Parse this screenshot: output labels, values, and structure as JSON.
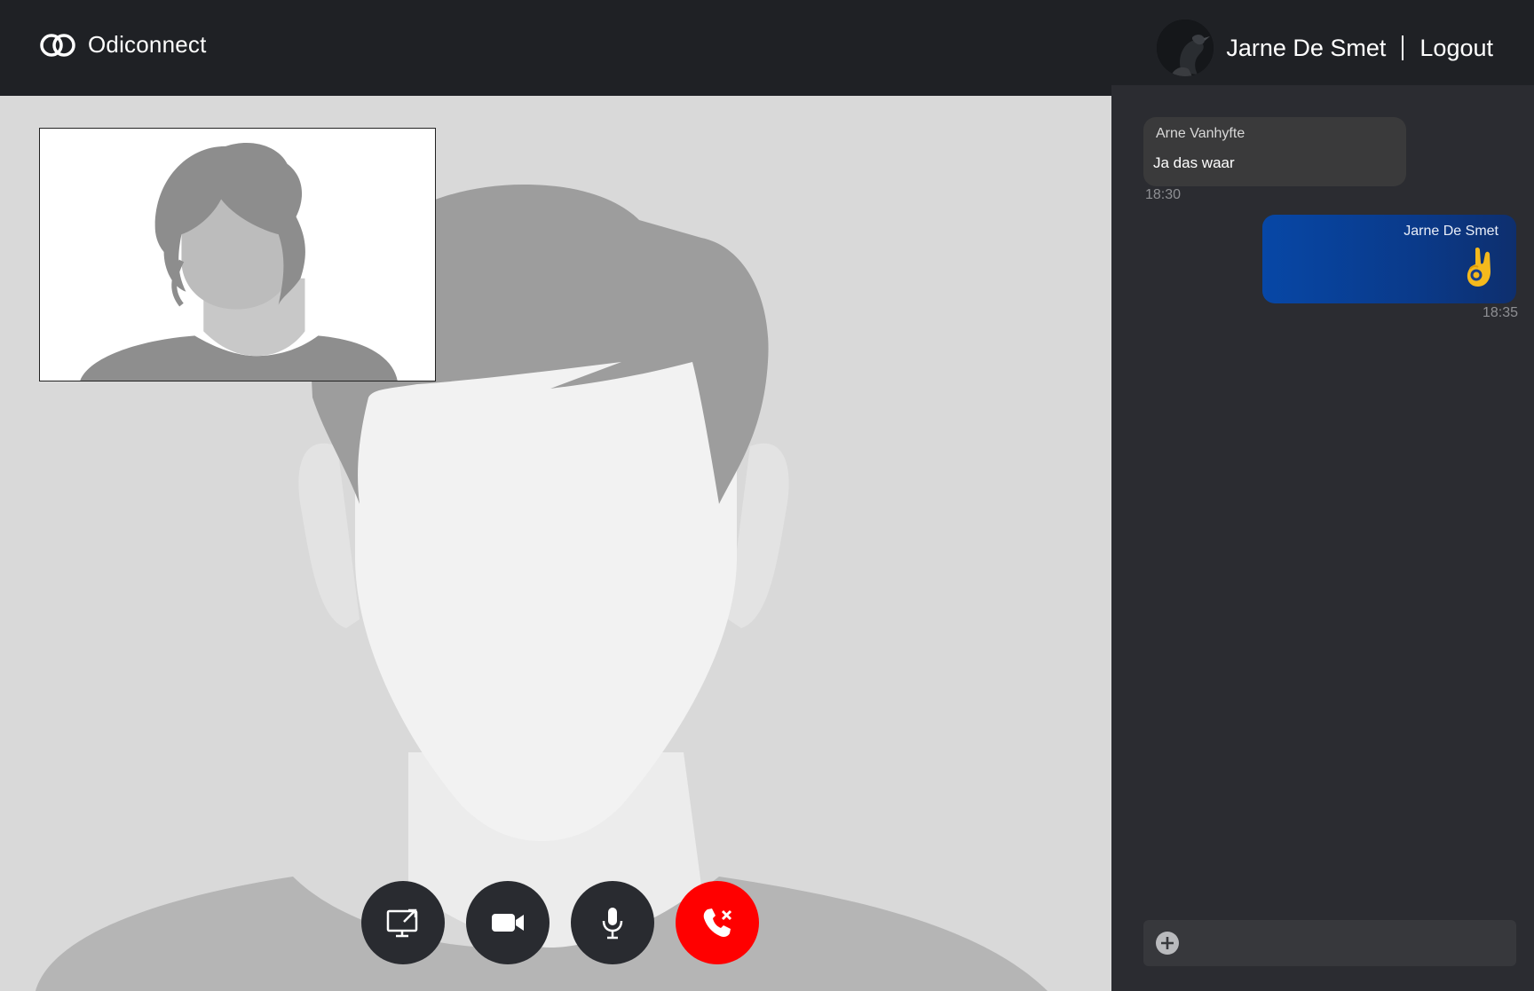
{
  "app": {
    "name": "Odiconnect",
    "logo_icon": "linked-rings-icon"
  },
  "header": {
    "user_name": "Jarne De Smet",
    "logout_label": "Logout",
    "avatar_icon": "user-avatar"
  },
  "call": {
    "controls": [
      {
        "name": "share-screen-button",
        "icon": "screen-share-icon"
      },
      {
        "name": "camera-button",
        "icon": "video-camera-icon"
      },
      {
        "name": "microphone-button",
        "icon": "microphone-icon"
      },
      {
        "name": "hang-up-button",
        "icon": "phone-hangup-icon"
      }
    ],
    "colors": {
      "control_bg": "#292b30",
      "hangup_bg": "#ff0000",
      "video_bg": "#d9d9d9"
    }
  },
  "chat": {
    "messages": [
      {
        "sender": "Arne Vanhyfte",
        "text": "Ja das waar",
        "time": "18:30",
        "direction": "incoming"
      },
      {
        "sender": "Jarne De Smet",
        "text": "👌",
        "time": "18:35",
        "direction": "outgoing"
      }
    ],
    "composer": {
      "placeholder": "",
      "add_icon": "plus-circle-icon"
    },
    "colors": {
      "panel_bg": "#2b2c31",
      "incoming_bg": "#3a3a3b",
      "outgoing_bg_start": "#0747a6",
      "outgoing_bg_end": "#0e2f6e"
    }
  }
}
